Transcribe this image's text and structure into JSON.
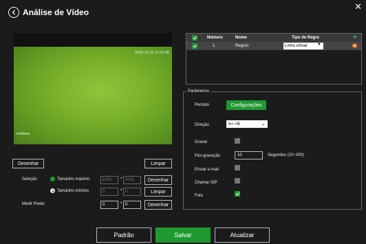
{
  "window": {
    "title": "Análise de Vídeo"
  },
  "video": {
    "timestamp": "2018-12-20 11:02:48",
    "camera_name": "Intelbras"
  },
  "draw": {
    "draw_label": "Desenhar",
    "clear_label": "Limpar"
  },
  "selection": {
    "label": "Seleção",
    "max_label": "Tamanho máximo",
    "min_label": "Tamanho mínimo",
    "max_w": "8191",
    "max_h": "8191",
    "min_w": "0",
    "min_h": "0",
    "draw_label": "Desenhar",
    "clear_label": "Limpar"
  },
  "measure": {
    "label": "Medir Pixels",
    "w": "0",
    "h": "0",
    "draw_label": "Desenhar"
  },
  "rules_table": {
    "headers": {
      "number": "Número",
      "name": "Nome",
      "rule_type": "Tipo de Regra"
    },
    "rows": [
      {
        "number": "1",
        "name": "Regra1",
        "rule_type": "Linha virtual"
      }
    ]
  },
  "params": {
    "legend": "Parâmetros",
    "period_label": "Período",
    "config_button": "Configurações",
    "direction_label": "Direção",
    "direction_value": "A<->B",
    "record_label": "Gravar",
    "post_record_label": "Pós-gravação",
    "post_record_value": "10",
    "post_record_hint": "Segundos (10~300)",
    "email_label": "Enviar e-mail",
    "sip_label": "Chamar SIP",
    "photo_label": "Foto"
  },
  "footer": {
    "default_label": "Padrão",
    "save_label": "Salvar",
    "refresh_label": "Atualizar"
  },
  "colors": {
    "accent": "#1f9a32",
    "background": "#1b1b1b"
  }
}
